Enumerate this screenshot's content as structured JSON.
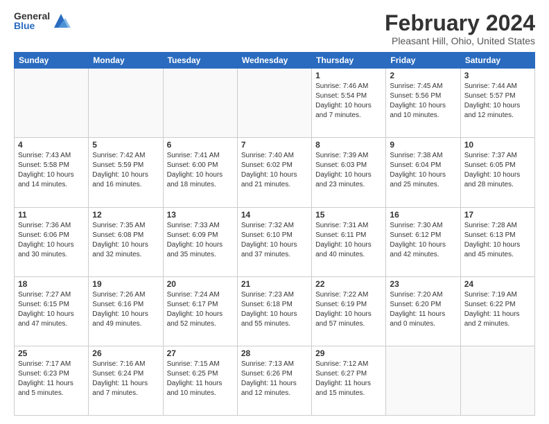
{
  "logo": {
    "general": "General",
    "blue": "Blue"
  },
  "header": {
    "title": "February 2024",
    "subtitle": "Pleasant Hill, Ohio, United States"
  },
  "weekdays": [
    "Sunday",
    "Monday",
    "Tuesday",
    "Wednesday",
    "Thursday",
    "Friday",
    "Saturday"
  ],
  "weeks": [
    [
      {
        "day": "",
        "info": ""
      },
      {
        "day": "",
        "info": ""
      },
      {
        "day": "",
        "info": ""
      },
      {
        "day": "",
        "info": ""
      },
      {
        "day": "1",
        "info": "Sunrise: 7:46 AM\nSunset: 5:54 PM\nDaylight: 10 hours\nand 7 minutes."
      },
      {
        "day": "2",
        "info": "Sunrise: 7:45 AM\nSunset: 5:56 PM\nDaylight: 10 hours\nand 10 minutes."
      },
      {
        "day": "3",
        "info": "Sunrise: 7:44 AM\nSunset: 5:57 PM\nDaylight: 10 hours\nand 12 minutes."
      }
    ],
    [
      {
        "day": "4",
        "info": "Sunrise: 7:43 AM\nSunset: 5:58 PM\nDaylight: 10 hours\nand 14 minutes."
      },
      {
        "day": "5",
        "info": "Sunrise: 7:42 AM\nSunset: 5:59 PM\nDaylight: 10 hours\nand 16 minutes."
      },
      {
        "day": "6",
        "info": "Sunrise: 7:41 AM\nSunset: 6:00 PM\nDaylight: 10 hours\nand 18 minutes."
      },
      {
        "day": "7",
        "info": "Sunrise: 7:40 AM\nSunset: 6:02 PM\nDaylight: 10 hours\nand 21 minutes."
      },
      {
        "day": "8",
        "info": "Sunrise: 7:39 AM\nSunset: 6:03 PM\nDaylight: 10 hours\nand 23 minutes."
      },
      {
        "day": "9",
        "info": "Sunrise: 7:38 AM\nSunset: 6:04 PM\nDaylight: 10 hours\nand 25 minutes."
      },
      {
        "day": "10",
        "info": "Sunrise: 7:37 AM\nSunset: 6:05 PM\nDaylight: 10 hours\nand 28 minutes."
      }
    ],
    [
      {
        "day": "11",
        "info": "Sunrise: 7:36 AM\nSunset: 6:06 PM\nDaylight: 10 hours\nand 30 minutes."
      },
      {
        "day": "12",
        "info": "Sunrise: 7:35 AM\nSunset: 6:08 PM\nDaylight: 10 hours\nand 32 minutes."
      },
      {
        "day": "13",
        "info": "Sunrise: 7:33 AM\nSunset: 6:09 PM\nDaylight: 10 hours\nand 35 minutes."
      },
      {
        "day": "14",
        "info": "Sunrise: 7:32 AM\nSunset: 6:10 PM\nDaylight: 10 hours\nand 37 minutes."
      },
      {
        "day": "15",
        "info": "Sunrise: 7:31 AM\nSunset: 6:11 PM\nDaylight: 10 hours\nand 40 minutes."
      },
      {
        "day": "16",
        "info": "Sunrise: 7:30 AM\nSunset: 6:12 PM\nDaylight: 10 hours\nand 42 minutes."
      },
      {
        "day": "17",
        "info": "Sunrise: 7:28 AM\nSunset: 6:13 PM\nDaylight: 10 hours\nand 45 minutes."
      }
    ],
    [
      {
        "day": "18",
        "info": "Sunrise: 7:27 AM\nSunset: 6:15 PM\nDaylight: 10 hours\nand 47 minutes."
      },
      {
        "day": "19",
        "info": "Sunrise: 7:26 AM\nSunset: 6:16 PM\nDaylight: 10 hours\nand 49 minutes."
      },
      {
        "day": "20",
        "info": "Sunrise: 7:24 AM\nSunset: 6:17 PM\nDaylight: 10 hours\nand 52 minutes."
      },
      {
        "day": "21",
        "info": "Sunrise: 7:23 AM\nSunset: 6:18 PM\nDaylight: 10 hours\nand 55 minutes."
      },
      {
        "day": "22",
        "info": "Sunrise: 7:22 AM\nSunset: 6:19 PM\nDaylight: 10 hours\nand 57 minutes."
      },
      {
        "day": "23",
        "info": "Sunrise: 7:20 AM\nSunset: 6:20 PM\nDaylight: 11 hours\nand 0 minutes."
      },
      {
        "day": "24",
        "info": "Sunrise: 7:19 AM\nSunset: 6:22 PM\nDaylight: 11 hours\nand 2 minutes."
      }
    ],
    [
      {
        "day": "25",
        "info": "Sunrise: 7:17 AM\nSunset: 6:23 PM\nDaylight: 11 hours\nand 5 minutes."
      },
      {
        "day": "26",
        "info": "Sunrise: 7:16 AM\nSunset: 6:24 PM\nDaylight: 11 hours\nand 7 minutes."
      },
      {
        "day": "27",
        "info": "Sunrise: 7:15 AM\nSunset: 6:25 PM\nDaylight: 11 hours\nand 10 minutes."
      },
      {
        "day": "28",
        "info": "Sunrise: 7:13 AM\nSunset: 6:26 PM\nDaylight: 11 hours\nand 12 minutes."
      },
      {
        "day": "29",
        "info": "Sunrise: 7:12 AM\nSunset: 6:27 PM\nDaylight: 11 hours\nand 15 minutes."
      },
      {
        "day": "",
        "info": ""
      },
      {
        "day": "",
        "info": ""
      }
    ]
  ]
}
